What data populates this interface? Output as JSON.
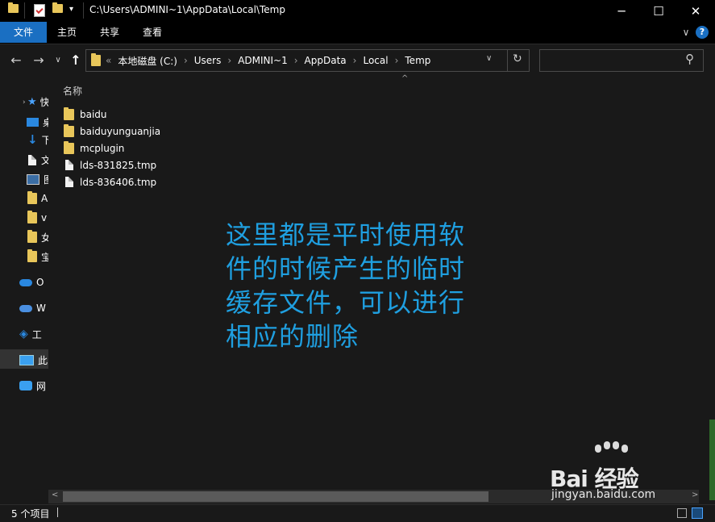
{
  "window": {
    "title_path": "C:\\Users\\ADMINI~1\\AppData\\Local\\Temp",
    "minimize": "─",
    "maximize": "☐",
    "close": "✕"
  },
  "ribbon": {
    "tabs": [
      "文件",
      "主页",
      "共享",
      "查看"
    ],
    "expand": "∨",
    "help": "?"
  },
  "nav": {
    "back": "←",
    "forward": "→",
    "recent": "∨",
    "up": "↑",
    "crumbs_prefix": "«",
    "crumbs": [
      "本地磁盘 (C:)",
      "Users",
      "ADMINI~1",
      "AppData",
      "Local",
      "Temp"
    ],
    "crumb_sep": "›",
    "dropdown": "∨",
    "refresh": "↻",
    "search_icon": "⚲"
  },
  "sidebar": {
    "items": [
      {
        "icon": "star-icon",
        "label": "快"
      },
      {
        "icon": "desktop-icon",
        "label": "桌"
      },
      {
        "icon": "download-icon",
        "label": "下"
      },
      {
        "icon": "document-icon",
        "label": "文"
      },
      {
        "icon": "picture-icon",
        "label": "图"
      },
      {
        "icon": "folder-icon",
        "label": "A"
      },
      {
        "icon": "folder-icon",
        "label": "v"
      },
      {
        "icon": "folder-icon",
        "label": "女"
      },
      {
        "icon": "folder-icon",
        "label": "宝"
      },
      {
        "icon": "onedrive-icon",
        "label": "O"
      },
      {
        "icon": "wps-cloud-icon",
        "label": "W"
      },
      {
        "icon": "workbench-icon",
        "label": "工"
      },
      {
        "icon": "this-pc-icon",
        "label": "此"
      },
      {
        "icon": "network-icon",
        "label": "网"
      }
    ]
  },
  "content": {
    "column_header": "名称",
    "sort_indicator": "^",
    "files": [
      {
        "name": "baidu",
        "type": "folder"
      },
      {
        "name": "baiduyunguanjia",
        "type": "folder"
      },
      {
        "name": "mcplugin",
        "type": "folder"
      },
      {
        "name": "lds-831825.tmp",
        "type": "file"
      },
      {
        "name": "lds-836406.tmp",
        "type": "file"
      }
    ],
    "annotation": "这里都是平时使用软件的时候产生的临时缓存文件，可以进行相应的删除"
  },
  "scroll": {
    "left_arrow": "<",
    "right_arrow": ">"
  },
  "status": {
    "item_count": "5 个项目"
  },
  "watermark": {
    "logo": "Bai 经验",
    "url": "jingyan.baidu.com"
  },
  "colors": {
    "accent": "#1a6fc2",
    "annotation": "#1f9fe0",
    "folder": "#e8c65a"
  }
}
